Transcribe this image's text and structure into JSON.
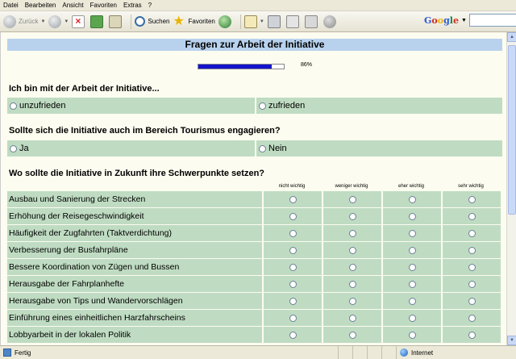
{
  "menu": [
    "Datei",
    "Bearbeiten",
    "Ansicht",
    "Favoriten",
    "Extras",
    "?"
  ],
  "toolbar": {
    "back_label": "Zurück",
    "search_label": "Suchen",
    "favorites_label": "Favoriten"
  },
  "google": {
    "brand": [
      "G",
      "o",
      "o",
      "g",
      "l",
      "e"
    ]
  },
  "page": {
    "title": "Fragen zur Arbeit der Initiative",
    "progress": {
      "percent": 86,
      "label": "86%"
    },
    "q1": {
      "text": "Ich bin mit der Arbeit der Initiative...",
      "options": [
        "unzufrieden",
        "zufrieden"
      ]
    },
    "q2": {
      "text": "Sollte sich die Initiative auch im Bereich Tourismus engagieren?",
      "options": [
        "Ja",
        "Nein"
      ]
    },
    "q3": {
      "text": "Wo sollte die Initiative in Zukunft ihre Schwerpunkte setzen?",
      "columns": [
        "nicht wichtig",
        "weniger wichtig",
        "eher wichtig",
        "sehr wichtig"
      ],
      "rows": [
        "Ausbau und Sanierung der Strecken",
        "Erhöhung der Reisegeschwindigkeit",
        "Häufigkeit der Zugfahrten (Taktverdichtung)",
        "Verbesserung der Busfahrpläne",
        "Bessere Koordination von Zügen und Bussen",
        "Herausgabe der Fahrplanhefte",
        "Herausgabe von Tips und Wandervorschlägen",
        "Einführung eines einheitlichen Harzfahrscheins",
        "Lobbyarbeit in der lokalen Politik"
      ]
    }
  },
  "status": {
    "left": "Fertig",
    "zone": "Internet"
  }
}
